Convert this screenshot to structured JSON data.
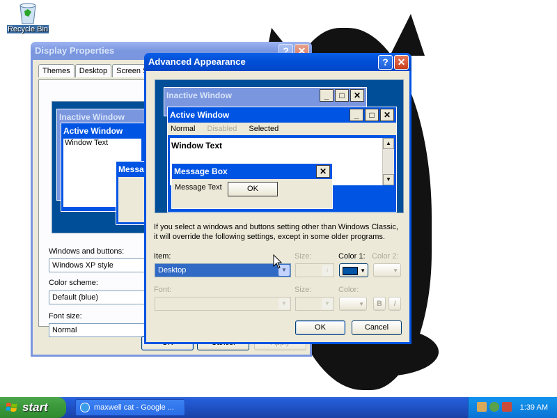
{
  "desktop": {
    "recycle_bin_label": "Recycle Bin"
  },
  "display_properties": {
    "title": "Display Properties",
    "tabs": [
      {
        "label": "Themes"
      },
      {
        "label": "Desktop"
      },
      {
        "label": "Screen S"
      }
    ],
    "preview": {
      "inactive_title": "Inactive Window",
      "active_title": "Active Window",
      "window_text": "Window Text",
      "message_title": "Messa"
    },
    "windows_buttons_label": "Windows and buttons:",
    "windows_buttons_value": "Windows XP style",
    "color_scheme_label": "Color scheme:",
    "color_scheme_value": "Default (blue)",
    "font_size_label": "Font size:",
    "font_size_value": "Normal",
    "ok_label": "OK",
    "cancel_label": "Cancel",
    "apply_label": "Apply"
  },
  "advanced_appearance": {
    "title": "Advanced Appearance",
    "help_icon": "help-icon",
    "preview": {
      "inactive_title": "Inactive Window",
      "active_title": "Active Window",
      "menu_normal": "Normal",
      "menu_disabled": "Disabled",
      "menu_selected": "Selected",
      "window_text": "Window Text",
      "message_title": "Message Box",
      "message_text": "Message Text",
      "message_ok": "OK"
    },
    "info_text_line1": "If you select a windows and buttons setting other than Windows Classic,",
    "info_text_line2": "it will override the following settings, except in some older programs.",
    "item_label": "Item:",
    "item_value": "Desktop",
    "size_label": "Size:",
    "color1_label": "Color 1:",
    "color1_value": "#0054a6",
    "color2_label": "Color 2:",
    "font_label": "Font:",
    "font_size_label": "Size:",
    "font_color_label": "Color:",
    "bold_label": "B",
    "italic_label": "I",
    "ok_label": "OK",
    "cancel_label": "Cancel"
  },
  "taskbar": {
    "start_label": "start",
    "task_label": "maxwell cat - Google ...",
    "clock": "1:39 AM"
  },
  "colors": {
    "desktop_preview": "#004e98",
    "active_title": "#0054e3",
    "inactive_title": "#7a96df",
    "dialog_bg": "#ece9d8"
  }
}
